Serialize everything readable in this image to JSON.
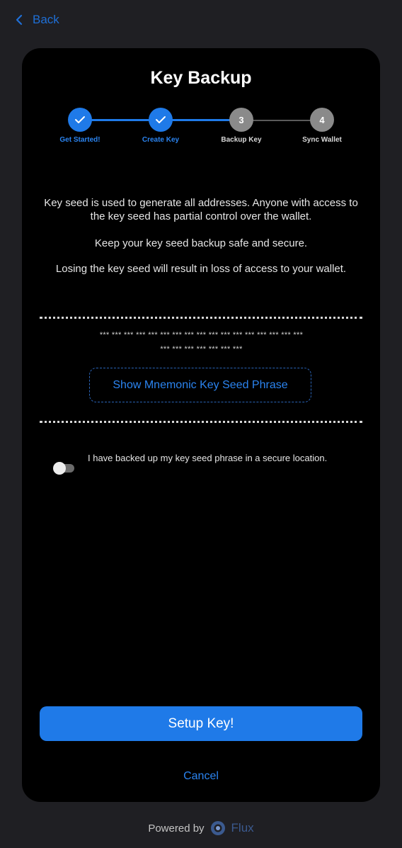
{
  "nav": {
    "back_label": "Back"
  },
  "header": {
    "title": "Key Backup"
  },
  "steps": [
    {
      "number": "1",
      "label": "Get Started!",
      "status": "done"
    },
    {
      "number": "2",
      "label": "Create Key",
      "status": "done"
    },
    {
      "number": "3",
      "label": "Backup Key",
      "status": "todo"
    },
    {
      "number": "4",
      "label": "Sync Wallet",
      "status": "todo"
    }
  ],
  "info": {
    "paragraph1": "Key seed is used to generate all addresses. Anyone with access to the key seed has partial control over the wallet.",
    "paragraph2": "Keep your key seed backup safe and secure.",
    "paragraph3": "Losing the key seed will result in loss of access to your wallet."
  },
  "seed": {
    "masked_line1": "*** *** *** *** *** *** *** *** *** *** *** *** *** *** *** *** ***",
    "masked_line2": "*** *** *** *** *** *** ***",
    "show_button_label": "Show Mnemonic Key Seed Phrase"
  },
  "confirmation": {
    "toggle_on": false,
    "label": "I have backed up my key seed phrase in a secure location."
  },
  "actions": {
    "primary_label": "Setup Key!",
    "cancel_label": "Cancel"
  },
  "footer": {
    "powered_by": "Powered by",
    "brand": "Flux"
  },
  "colors": {
    "accent": "#1f7ae8",
    "background": "#1f1f23",
    "card": "#000000",
    "inactive_step": "#8a8a8a"
  }
}
